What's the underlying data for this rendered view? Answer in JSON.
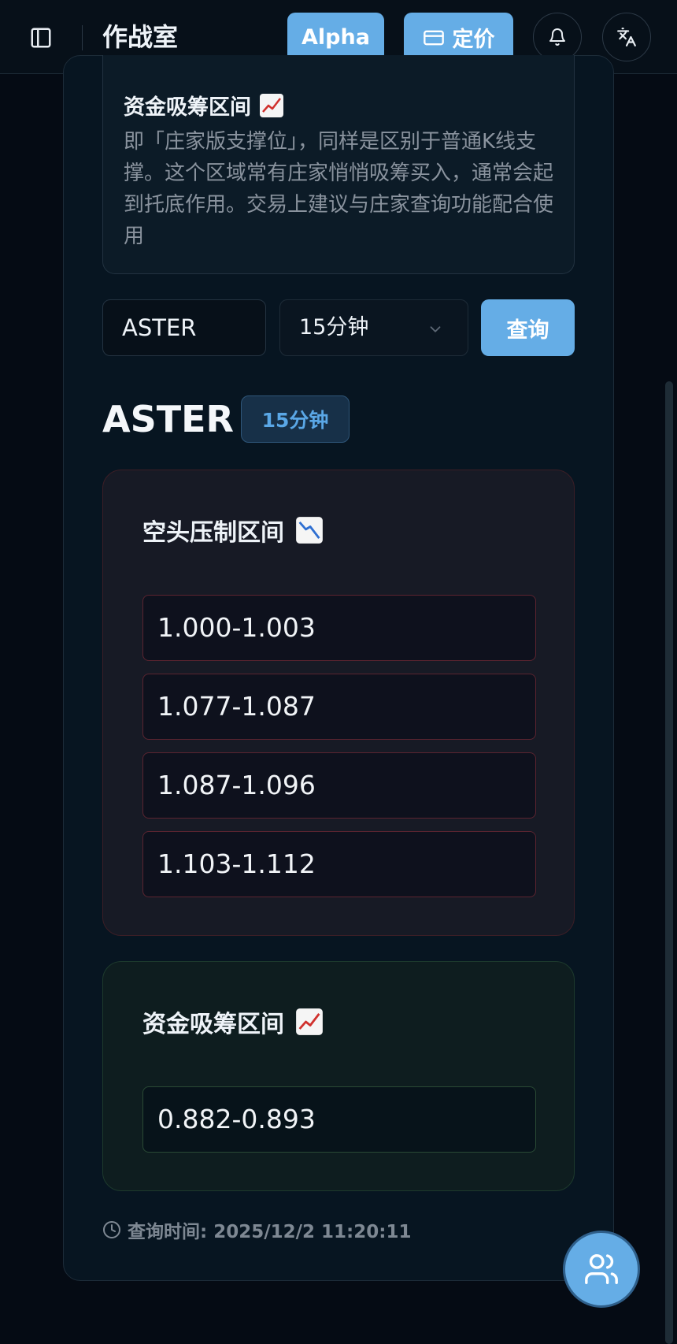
{
  "header": {
    "app_title": "作战室",
    "alpha_label": "Alpha",
    "pricing_label": "定价",
    "icons": [
      "sidebar-icon",
      "card-icon",
      "bell-icon",
      "translate-icon"
    ]
  },
  "info_box": {
    "title": "资金吸筹区间",
    "title_icon": "chart-increasing-icon",
    "description": "即「庄家版支撑位」，同样是区别于普通K线支撑。这个区域常有庄家悄悄吸筹买入，通常会起到托底作用。交易上建议与庄家查询功能配合使用"
  },
  "query": {
    "symbol_value": "ASTER",
    "interval_value": "15分钟",
    "submit_label": "查询"
  },
  "result": {
    "symbol": "ASTER",
    "interval_badge": "15分钟",
    "resistance": {
      "title": "空头压制区间",
      "title_icon": "chart-decreasing-icon",
      "zones": [
        "1.000-1.003",
        "1.077-1.087",
        "1.087-1.096",
        "1.103-1.112"
      ],
      "accent_color": "#5b2430"
    },
    "accumulation": {
      "title": "资金吸筹区间",
      "title_icon": "chart-increasing-icon",
      "zones": [
        "0.882-0.893"
      ],
      "accent_color": "#2a4a35"
    },
    "query_time": "查询时间: 2025/12/2 11:20:11"
  },
  "colors": {
    "accent": "#65ade6",
    "background": "#050b14",
    "badge_text": "#5aa7e6"
  },
  "floating": {
    "chat_icon": "users-icon"
  }
}
